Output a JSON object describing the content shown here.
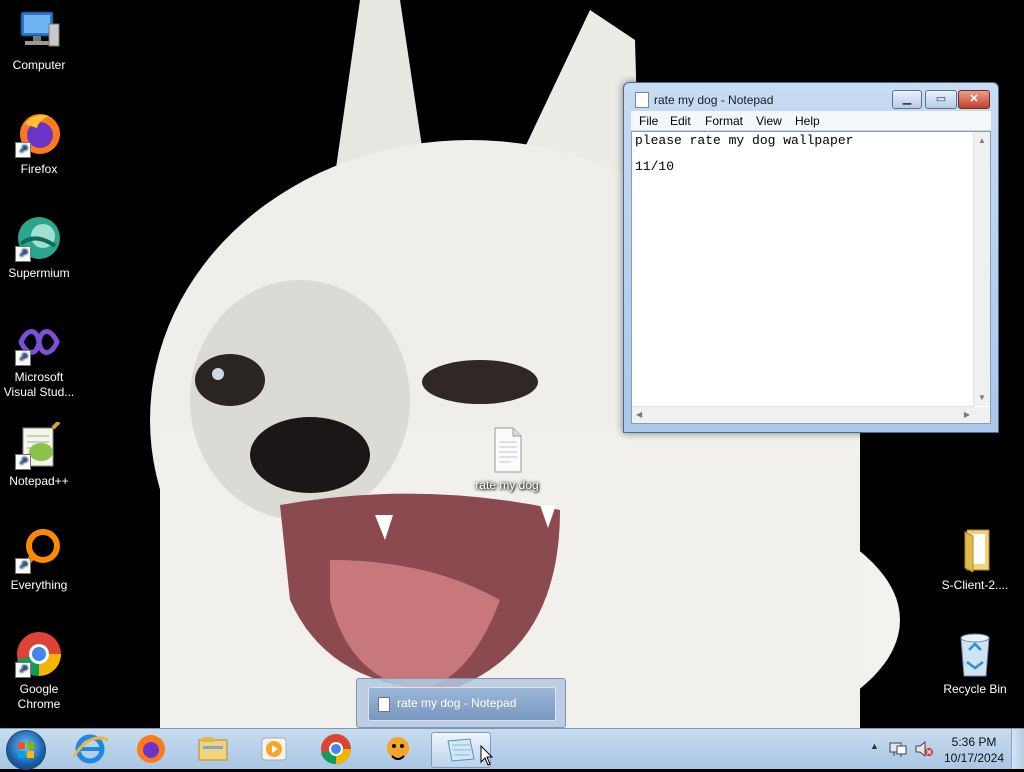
{
  "desktop": {
    "icons": [
      {
        "label": "Computer",
        "icon": "computer-icon",
        "shortcut": false
      },
      {
        "label": "Firefox",
        "icon": "firefox-icon",
        "shortcut": true
      },
      {
        "label": "Supermium",
        "icon": "supermium-icon",
        "shortcut": true
      },
      {
        "label": "Microsoft Visual Stud...",
        "icon": "visual-studio-icon",
        "shortcut": true
      },
      {
        "label": "Notepad++",
        "icon": "notepad-plus-plus-icon",
        "shortcut": true
      },
      {
        "label": "Everything",
        "icon": "everything-search-icon",
        "shortcut": true
      },
      {
        "label": "Google Chrome",
        "icon": "chrome-icon",
        "shortcut": true
      },
      {
        "label": "rate my dog",
        "icon": "text-file-icon",
        "shortcut": false
      },
      {
        "label": "S-Client-2....",
        "icon": "folder-icon",
        "shortcut": false
      },
      {
        "label": "Recycle Bin",
        "icon": "recycle-bin-icon",
        "shortcut": false
      }
    ],
    "wallpaper": "white-dog-wallpaper"
  },
  "notepad": {
    "title": "rate my dog - Notepad",
    "menu": [
      "File",
      "Edit",
      "Format",
      "View",
      "Help"
    ],
    "content_line1": "please rate my dog wallpaper",
    "content_line2": "",
    "content_line3": "11/10",
    "buttons": {
      "minimize": "minimize",
      "maximize": "maximize",
      "close": "close"
    }
  },
  "taskbar": {
    "pinned": [
      {
        "name": "start-button",
        "icon": "windows-orb-icon"
      },
      {
        "name": "internet-explorer",
        "icon": "internet-explorer-icon"
      },
      {
        "name": "firefox",
        "icon": "firefox-icon"
      },
      {
        "name": "file-explorer",
        "icon": "folder-icon"
      },
      {
        "name": "media-player",
        "icon": "media-player-icon"
      },
      {
        "name": "chrome",
        "icon": "chrome-icon"
      },
      {
        "name": "app-orange",
        "icon": "orange-character-icon"
      },
      {
        "name": "notepad",
        "icon": "notepad-icon",
        "active": true
      }
    ],
    "preview_label": "rate my dog - Notepad",
    "clock_time": "5:36 PM",
    "clock_date": "10/17/2024",
    "tray": [
      "show-hidden-icons",
      "network-icon",
      "volume-muted-icon"
    ]
  },
  "colors": {
    "taskbar": "#b5cfe8",
    "notepad_frame": "#b9d1ee",
    "close_red": "#c2402a",
    "wallpaper_bg": "#000000"
  }
}
